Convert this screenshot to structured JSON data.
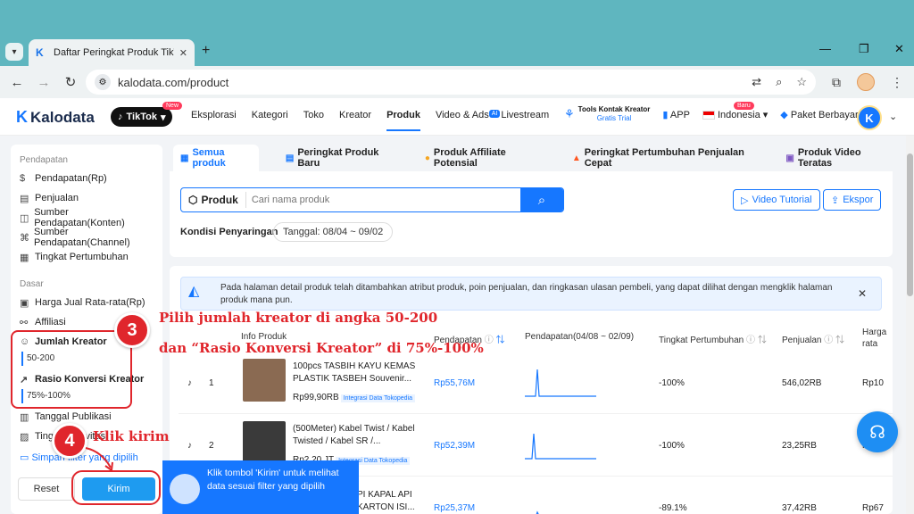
{
  "browser": {
    "tab_title": "Daftar Peringkat Produk TikTok",
    "url": "kalodata.com/product"
  },
  "header": {
    "logo": "Kalodata",
    "platform": "TikTok",
    "platform_badge": "New",
    "nav": [
      "Eksplorasi",
      "Kategori",
      "Toko",
      "Kreator",
      "Produk",
      "Video & Ads",
      "Livestream"
    ],
    "ai_badge": "AI",
    "tools_line1": "Tools Kontak Kreator",
    "tools_line2": "Gratis Trial",
    "app": "APP",
    "country": "Indonesia",
    "country_badge": "Baru",
    "plan": "Paket Berbayar",
    "avatar_letter": "K"
  },
  "sidebar": {
    "section1": "Pendapatan",
    "items1": [
      "Pendapatan(Rp)",
      "Penjualan",
      "Sumber Pendapatan(Konten)",
      "Sumber Pendapatan(Channel)",
      "Tingkat Pertumbuhan"
    ],
    "section2": "Dasar",
    "items2": [
      "Harga Jual Rata-rata(Rp)",
      "Affiliasi"
    ],
    "creator_label": "Jumlah Kreator",
    "creator_value": "50-200",
    "ratio_label": "Rasio Konversi Kreator",
    "ratio_value": "75%-100%",
    "items3": [
      "Tanggal Publikasi",
      "Tingkat Aktivitas"
    ],
    "save_filter": "Simpan filter yang dipilih",
    "reset": "Reset",
    "submit": "Kirim"
  },
  "tabs": [
    "Semua produk",
    "Peringkat Produk Baru",
    "Produk Affiliate Potensial",
    "Peringkat Pertumbuhan Penjualan Cepat",
    "Produk Video Teratas"
  ],
  "search": {
    "scope": "Produk",
    "placeholder": "Cari nama produk",
    "video_tutorial": "Video Tutorial",
    "export": "Ekspor",
    "filter_label": "Kondisi Penyaringan",
    "date_chip": "Tanggal: 08/04 ~ 09/02"
  },
  "notice": "Pada halaman detail produk telah ditambahkan atribut produk, poin penjualan, dan ringkasan ulasan pembeli, yang dapat dilihat dengan mengklik halaman produk mana pun.",
  "table": {
    "headers": [
      "Info Produk",
      "Pendapatan",
      "Pendapatan(04/08 ~ 02/09)",
      "Tingkat Pertumbuhan",
      "Penjualan",
      "Harga rata"
    ],
    "rows": [
      {
        "rank": "1",
        "name": "100pcs TASBIH KAYU KEMAS PLASTIK TASBEH Souvenir...",
        "price": "Rp99,90RB",
        "badge": "Integrasi Data Tokopedia",
        "revenue": "Rp55,76M",
        "growth": "-100%",
        "sales": "546,02RB",
        "avg": "Rp10"
      },
      {
        "rank": "2",
        "name": "(500Meter) Kabel Twist / Kabel Twisted / Kabel SR /...",
        "price": "Rp2,20 JT",
        "badge": "Integrasi Data Tokopedia",
        "revenue": "Rp52,39M",
        "growth": "-100%",
        "sales": "23,25RB",
        "avg": "Rp2"
      },
      {
        "rank": "",
        "name": "PI KAPAL API KARTON ISI...",
        "price": "",
        "badge": "",
        "revenue": "Rp25,37M",
        "growth": "-89.1%",
        "sales": "37,42RB",
        "avg": "Rp67"
      }
    ]
  },
  "annotations": {
    "step3": "3",
    "step3_line1": "Pilih jumlah kreator di angka 50-200",
    "step3_line2": "dan “Rasio Konversi Kreator” di 75%-100%",
    "step4": "4",
    "step4_text": "Klik kirim",
    "tooltip": "Klik tombol 'Kirim' untuk melihat data sesuai filter yang dipilih"
  }
}
